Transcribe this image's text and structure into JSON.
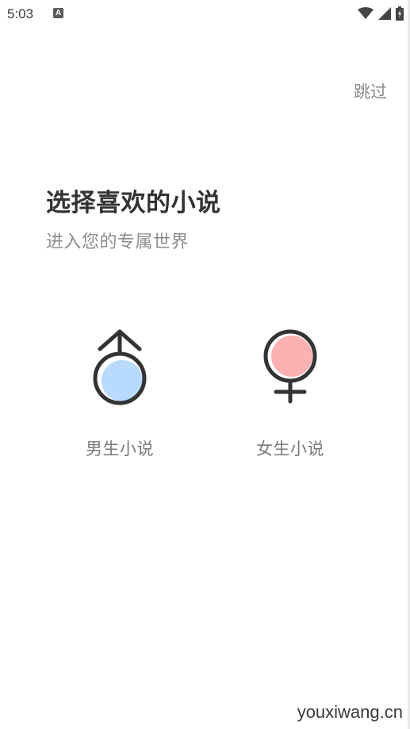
{
  "status_bar": {
    "time": "5:03",
    "notification_icon_letter": "A",
    "icons": [
      "wifi-icon",
      "signal-icon",
      "battery-icon"
    ]
  },
  "header": {
    "skip_label": "跳过"
  },
  "main": {
    "title": "选择喜欢的小说",
    "subtitle": "进入您的专属世界",
    "options": [
      {
        "label": "男生小说",
        "icon": "male-symbol-icon",
        "fill_color": "#b8dafd"
      },
      {
        "label": "女生小说",
        "icon": "female-symbol-icon",
        "fill_color": "#fdb1b2"
      }
    ]
  },
  "watermark": "youxiwang.cn",
  "colors": {
    "icon_stroke": "#333333",
    "title": "#333333",
    "subtitle": "#8c8c8c"
  }
}
